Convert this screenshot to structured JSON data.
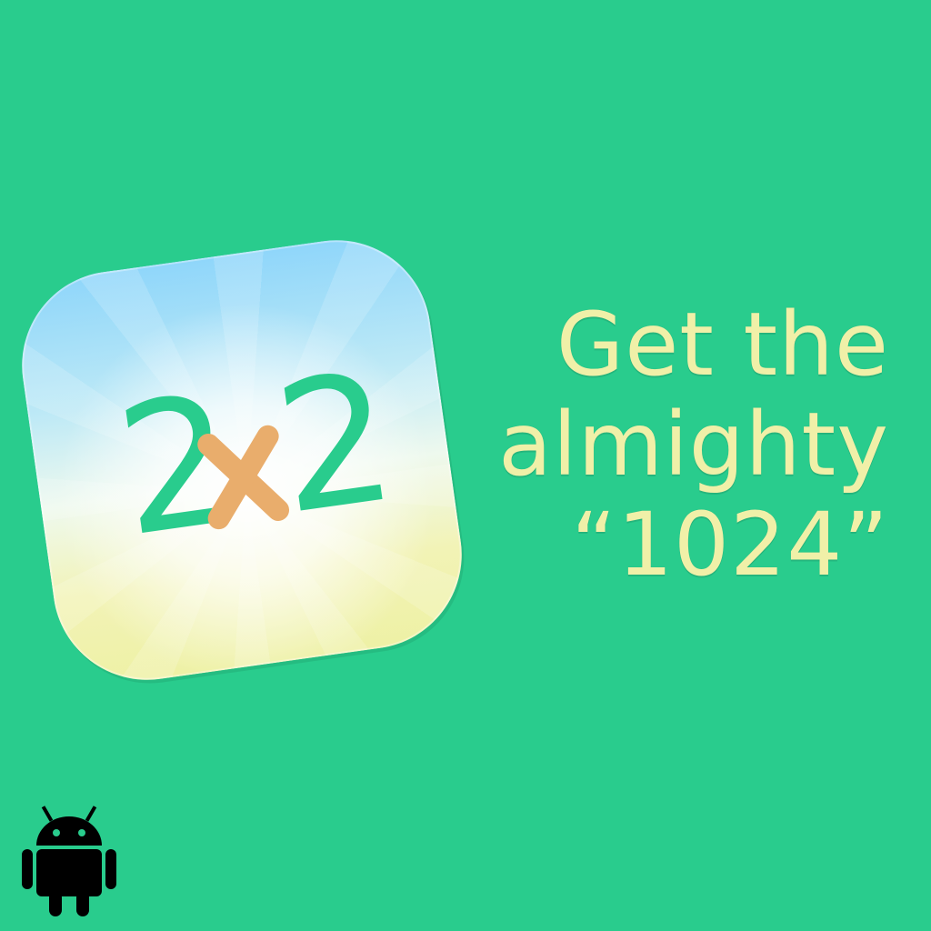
{
  "app_icon": {
    "left_digit": "2",
    "operator": "x",
    "right_digit": "2"
  },
  "tagline": {
    "line1": "Get the",
    "line2": "almighty",
    "line3": "“1024”"
  },
  "colors": {
    "background": "#29cc8d",
    "digits": "#29cc8d",
    "operator": "#e9ad6c",
    "tagline_text": "#f0f0a8",
    "android": "#000000"
  },
  "icons": {
    "platform": "android-icon"
  }
}
